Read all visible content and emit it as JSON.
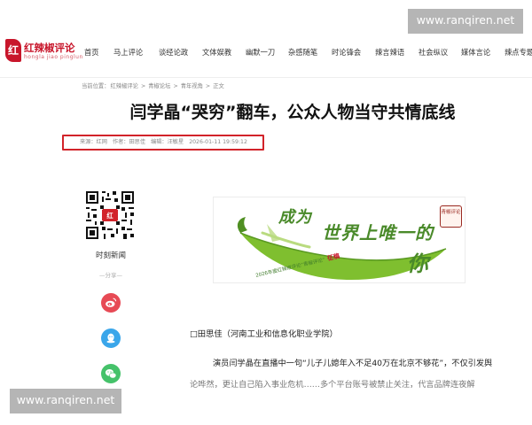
{
  "site": {
    "logo_mark": "红",
    "logo_name": "红辣椒评论",
    "logo_sub": "hongla jiao pinglun"
  },
  "watermark": {
    "top": "www.ranqiren.net",
    "bottom": "www.ranqiren.net"
  },
  "nav": {
    "items": [
      "首页",
      "马上评论",
      "谈经论政",
      "文体娱教",
      "幽默一刀",
      "杂感随笔",
      "时论锋会",
      "辣言辣语",
      "社会纵议",
      "媒体言论",
      "辣点专题"
    ]
  },
  "breadcrumb": {
    "label": "当前位置：",
    "items": [
      "红辣椒评论",
      "青椒论坛",
      "青年视角",
      "正文"
    ],
    "sep": " > "
  },
  "article": {
    "title": "闫学晶“哭穷”翻车，公众人物当守共情底线",
    "meta": {
      "source": "来源：红网",
      "author": "作者：田思佳",
      "editor": "编辑：汪敏星",
      "datetime": "2026-01-11 19:59:12"
    },
    "author_line": "□田思佳（河南工业和信息化职业学院）",
    "paragraph_1": "演员闫学晶在直播中一句“儿子儿媳年入不足40万在北京不够花”，不仅引发舆",
    "paragraph_2": "论哗然，更让自己陷入事业危机……多个平台账号被禁止关注，代言品牌连夜解"
  },
  "left_panel": {
    "qr_label": "时刻新闻",
    "share_label": "—分享—"
  },
  "banner": {
    "line1": "成为",
    "line2": "世界上唯一的",
    "line3": "你",
    "note": "2026年度红辣椒评论“青椒评论”",
    "note_badge": "征稿",
    "stamp": "青椒评论"
  },
  "colors": {
    "brand_red": "#c8162b",
    "highlight_border": "#d2232a",
    "banner_green": "#4a8a2a",
    "weibo": "#e74a55",
    "qq": "#3aa6ea",
    "wechat": "#45c26a"
  }
}
